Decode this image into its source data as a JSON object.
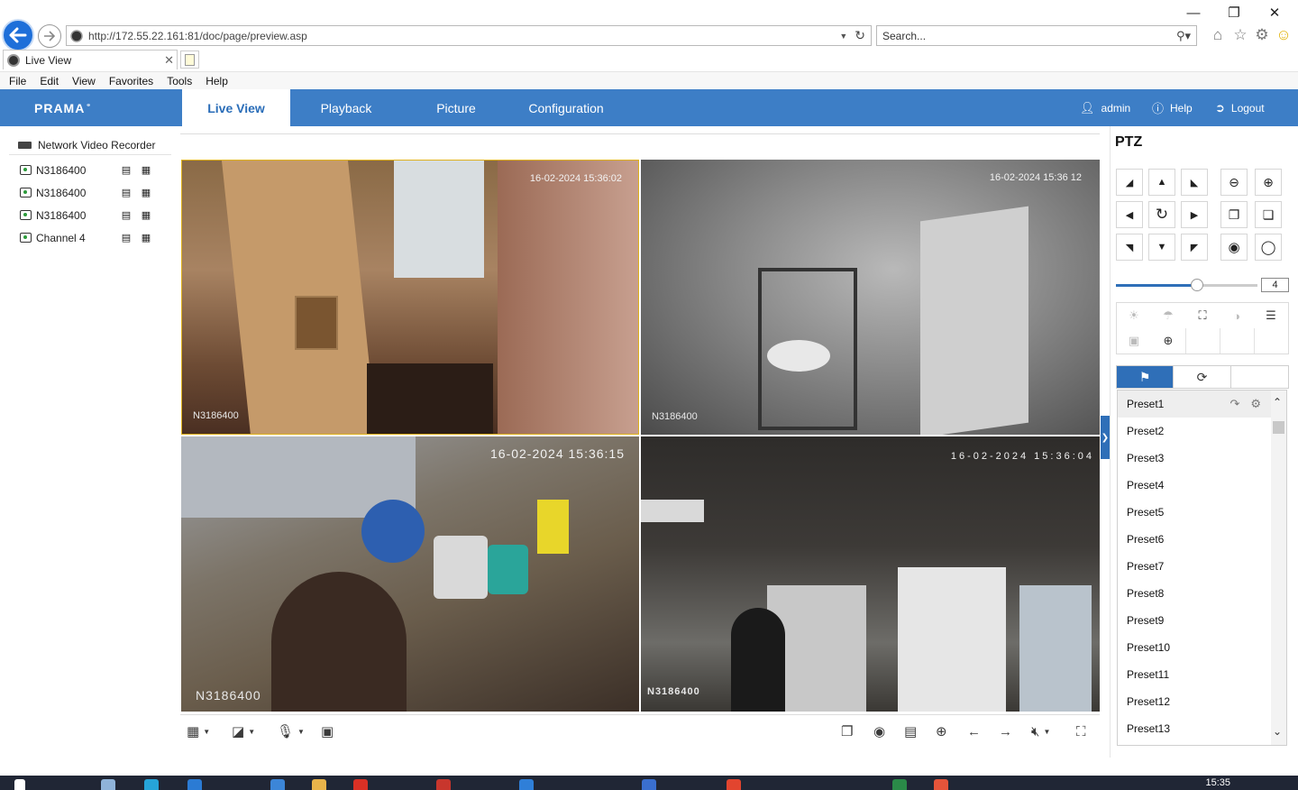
{
  "browser": {
    "url": "http://172.55.22.161:81/doc/page/preview.asp",
    "search_placeholder": "Search...",
    "tab_title": "Live View",
    "menu": [
      "File",
      "Edit",
      "View",
      "Favorites",
      "Tools",
      "Help"
    ],
    "icons": [
      "back-arrow-icon",
      "forward-arrow-icon",
      "refresh-icon",
      "home-icon",
      "star-icon",
      "gear-icon",
      "smiley-icon"
    ]
  },
  "app": {
    "logo": "PRAMA",
    "tabs": [
      "Live View",
      "Playback",
      "Picture",
      "Configuration"
    ],
    "active_tab": "Live View",
    "user": "admin",
    "help": "Help",
    "logout": "Logout",
    "header_color": "#3d7ec6"
  },
  "tree": {
    "root": "Network Video Recorder",
    "channels": [
      "N3186400",
      "N3186400",
      "N3186400",
      "Channel 4"
    ]
  },
  "video": {
    "tiles": [
      {
        "timestamp": "16-02-2024 15:36:02",
        "name": "N3186400"
      },
      {
        "timestamp": "16-02-2024 15:36 12",
        "name": "N3186400"
      },
      {
        "timestamp": "16-02-2024 15:36:15",
        "name": "N3186400"
      },
      {
        "timestamp": "16-02-2024 15:36:04",
        "name": "N3186400"
      }
    ]
  },
  "ptz": {
    "title": "PTZ",
    "speed": 4,
    "speed_max": 7,
    "presets": [
      "Preset1",
      "Preset2",
      "Preset3",
      "Preset4",
      "Preset5",
      "Preset6",
      "Preset7",
      "Preset8",
      "Preset9",
      "Preset10",
      "Preset11",
      "Preset12",
      "Preset13"
    ],
    "selected_preset": "Preset1"
  },
  "taskbar": {
    "clock": "15:35"
  }
}
